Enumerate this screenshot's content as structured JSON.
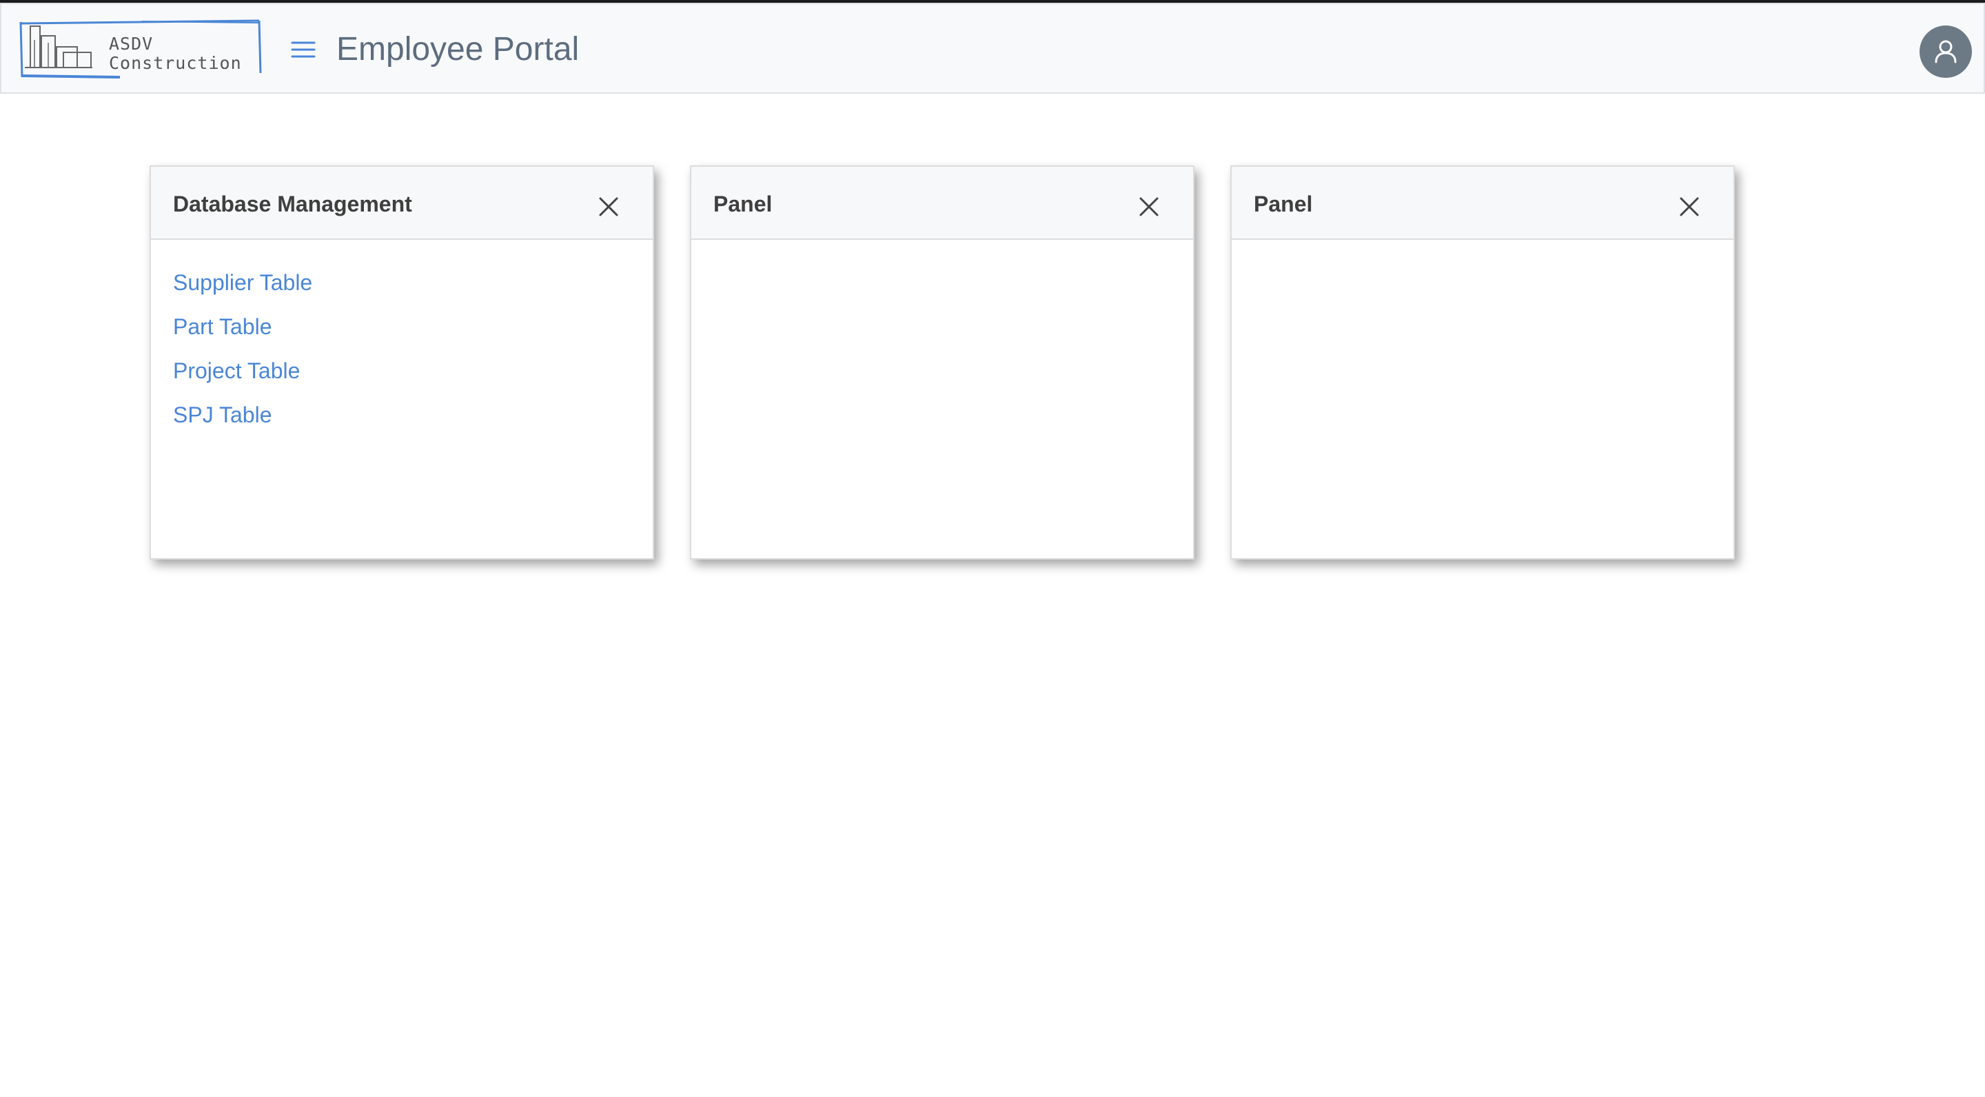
{
  "header": {
    "logo": {
      "line1": "ASDV",
      "line2": "Construction"
    },
    "title": "Employee Portal",
    "menu_icon": "hamburger-icon",
    "user_icon": "user-icon"
  },
  "panels": [
    {
      "title": "Database Management",
      "close_icon": "close-icon",
      "links": [
        "Supplier Table",
        "Part Table",
        "Project Table",
        "SPJ Table"
      ]
    },
    {
      "title": "Panel",
      "close_icon": "close-icon",
      "links": []
    },
    {
      "title": "Panel",
      "close_icon": "close-icon",
      "links": []
    }
  ],
  "colors": {
    "link": "#4a86d6",
    "header_bg": "#f8f9fa",
    "avatar_bg": "#6c7a86",
    "title_text": "#5d6d7e"
  }
}
